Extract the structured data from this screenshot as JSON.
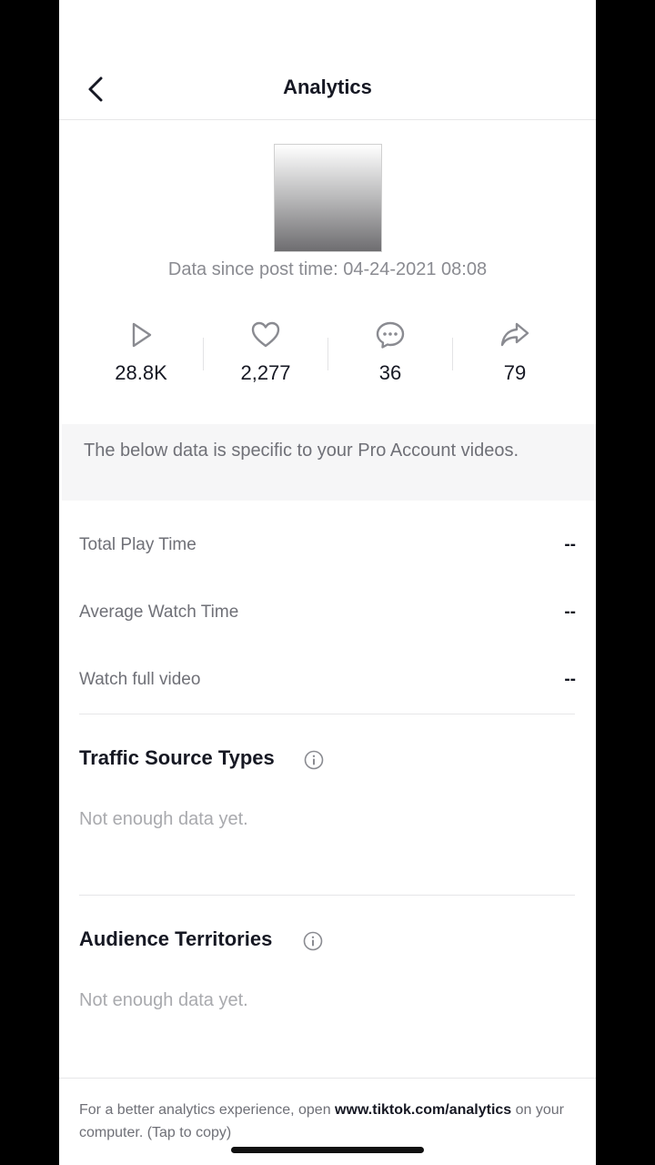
{
  "header": {
    "title": "Analytics",
    "back_icon": "chevron-left-icon"
  },
  "video": {
    "data_since": "Data since post time: 04-24-2021 08:08"
  },
  "stats": [
    {
      "icon": "play-icon",
      "value": "28.8K"
    },
    {
      "icon": "heart-icon",
      "value": "2,277"
    },
    {
      "icon": "comment-icon",
      "value": "36"
    },
    {
      "icon": "share-icon",
      "value": "79"
    }
  ],
  "pro_note": "The below data is specific to your Pro Account videos.",
  "metrics": [
    {
      "label": "Total Play Time",
      "value": "--"
    },
    {
      "label": "Average Watch Time",
      "value": "--"
    },
    {
      "label": "Watch full video",
      "value": "--"
    }
  ],
  "traffic": {
    "title": "Traffic Source Types",
    "empty": "Not enough data yet."
  },
  "territories": {
    "title": "Audience Territories",
    "empty": "Not enough data yet."
  },
  "footer": {
    "prefix": "For a better analytics experience, open ",
    "link": "www.tiktok.com/analytics",
    "suffix": " on your computer. (Tap to copy)"
  }
}
